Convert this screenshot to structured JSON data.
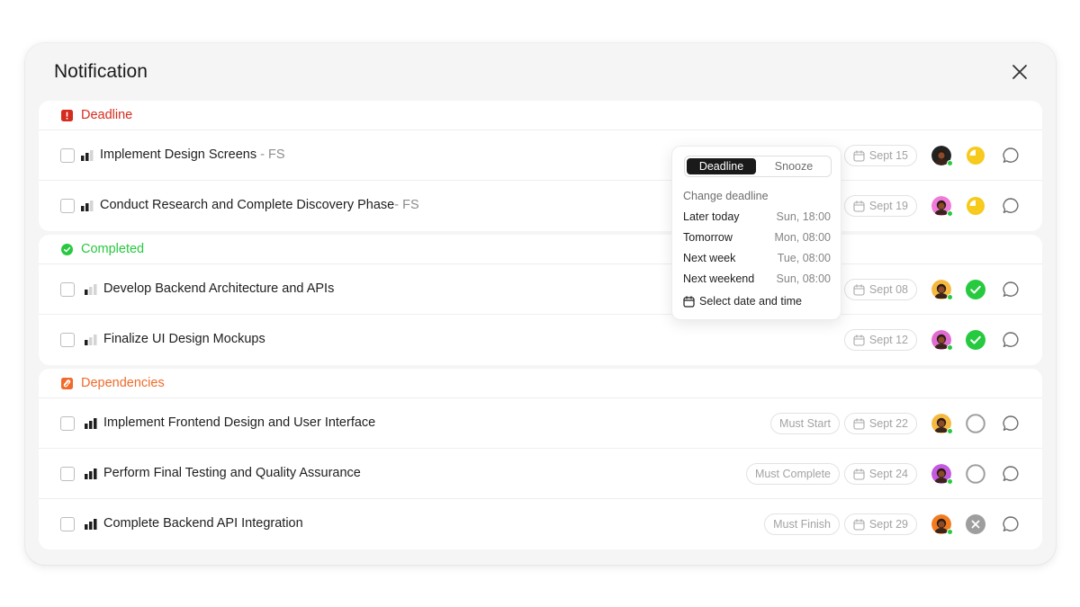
{
  "modal": {
    "title": "Notification"
  },
  "colors": {
    "deadline": "#d62b1f",
    "completed": "#27c93f",
    "dependencies": "#f06a2a",
    "yellow_status": "#f7c918",
    "green_status": "#27c93f",
    "grey_status": "#9e9e9e"
  },
  "sections": {
    "deadline": {
      "label": "Deadline",
      "icon": "exclamation-icon",
      "rows": [
        {
          "title": "Implement Design Screens",
          "suffix": " - FS",
          "priority": "medium",
          "date": "Sept 15",
          "status": "in-progress"
        },
        {
          "title": "Conduct Research and Complete Discovery Phase",
          "suffix": "- FS",
          "priority": "medium",
          "date": "Sept 19",
          "status": "in-progress"
        }
      ]
    },
    "completed": {
      "label": "Completed",
      "icon": "check-circle-icon",
      "rows": [
        {
          "title": "Develop Backend Architecture and APIs",
          "priority": "low",
          "date": "Sept 08",
          "status": "done"
        },
        {
          "title": "Finalize UI Design Mockups",
          "priority": "low",
          "date": "Sept 12",
          "status": "done"
        }
      ]
    },
    "dependencies": {
      "label": "Dependencies",
      "icon": "link-icon",
      "rows": [
        {
          "title": "Implement Frontend Design and User Interface",
          "priority": "high",
          "dependency": "Must Start",
          "date": "Sept 22",
          "status": "todo"
        },
        {
          "title": "Perform Final Testing and Quality Assurance",
          "priority": "high",
          "dependency": "Must Complete",
          "date": "Sept 24",
          "status": "todo"
        },
        {
          "title": "Complete Backend API Integration",
          "priority": "high",
          "dependency": "Must Finish",
          "date": "Sept 29",
          "status": "cancelled"
        }
      ]
    }
  },
  "popover": {
    "tabs": [
      "Deadline",
      "Snooze"
    ],
    "active_tab": "Deadline",
    "caption": "Change deadline",
    "options": [
      {
        "label": "Later today",
        "time": "Sun, 18:00"
      },
      {
        "label": "Tomorrow",
        "time": "Mon, 08:00"
      },
      {
        "label": "Next week",
        "time": "Tue, 08:00"
      },
      {
        "label": "Next weekend",
        "time": "Sun, 08:00"
      }
    ],
    "select_label": "Select date and time"
  }
}
